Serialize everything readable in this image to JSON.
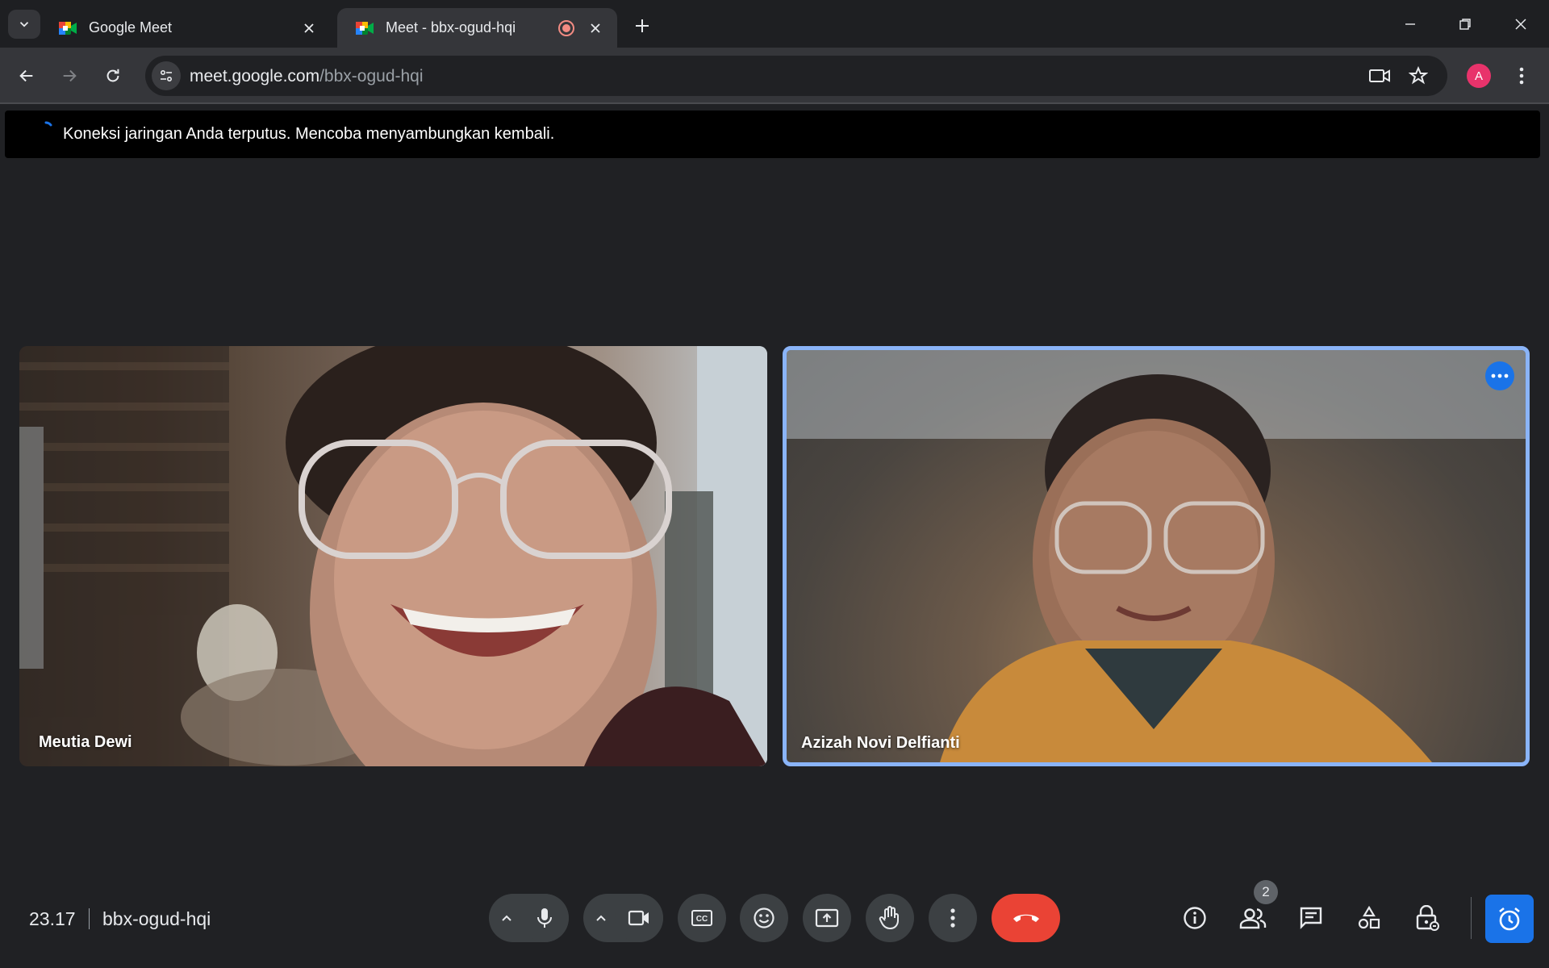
{
  "browser": {
    "tabs": [
      {
        "title": "Google Meet",
        "active": false
      },
      {
        "title": "Meet - bbx-ogud-hqi",
        "active": true,
        "recording": true
      }
    ],
    "url": {
      "host": "meet.google.com",
      "path": "/bbx-ogud-hqi"
    },
    "profile_initial": "A"
  },
  "banner": {
    "text": "Koneksi jaringan Anda terputus. Mencoba menyambungkan kembali."
  },
  "participants": [
    {
      "name": "Meutia Dewi",
      "active_speaker": false
    },
    {
      "name": "Azizah Novi Delfianti",
      "active_speaker": true
    }
  ],
  "meeting": {
    "time": "23.17",
    "code": "bbx-ogud-hqi",
    "participant_count": "2"
  },
  "controls": {
    "left": [
      "chevron-up-icon",
      "microphone-icon",
      "chevron-up-icon",
      "camera-icon",
      "captions-icon",
      "emoji-icon",
      "present-screen-icon",
      "raise-hand-icon",
      "more-options-icon",
      "end-call-icon"
    ],
    "right": [
      "info-icon",
      "people-icon",
      "chat-icon",
      "activities-icon",
      "host-controls-icon",
      "timer-icon"
    ]
  },
  "colors": {
    "accent": "#8ab4f8",
    "end_call": "#ea4335",
    "primary_blue": "#1a73e8",
    "background": "#202124"
  }
}
